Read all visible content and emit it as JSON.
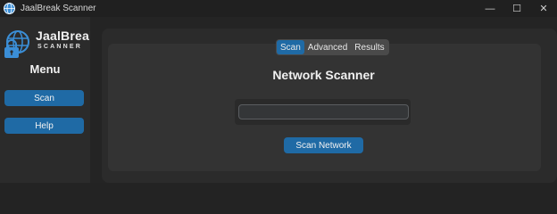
{
  "window": {
    "title": "JaalBreak Scanner",
    "controls": {
      "minimize": "—",
      "maximize": "☐",
      "close": "✕"
    }
  },
  "sidebar": {
    "logo_line1": "JaalBreak",
    "logo_line2": "SCANNER",
    "menu_title": "Menu",
    "buttons": [
      {
        "label": "Scan"
      },
      {
        "label": "Help"
      }
    ]
  },
  "tabs": [
    {
      "label": "Scan",
      "active": true
    },
    {
      "label": "Advanced",
      "active": false
    },
    {
      "label": "Results",
      "active": false
    }
  ],
  "main": {
    "title": "Network Scanner",
    "input_value": "",
    "scan_button": "Scan Network"
  },
  "colors": {
    "accent": "#1f6aa5",
    "logo_blue": "#3b8ed6",
    "background": "#242424"
  }
}
